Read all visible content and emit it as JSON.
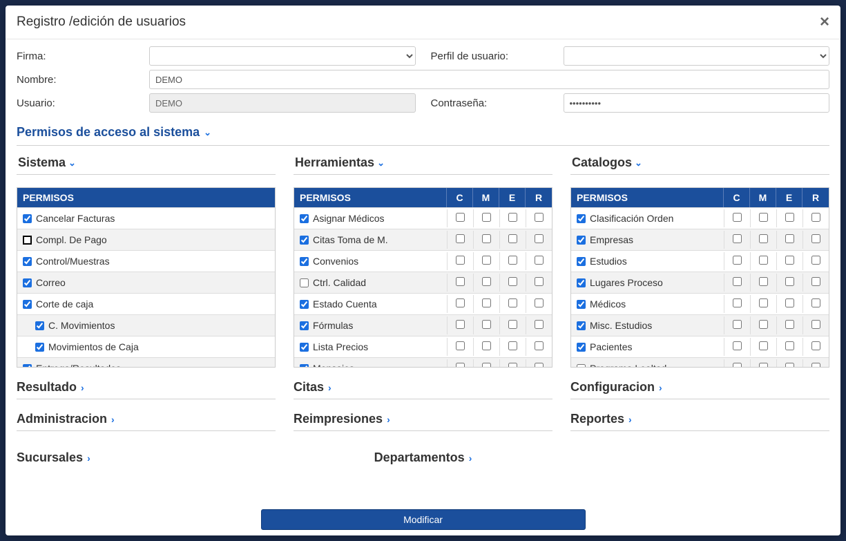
{
  "modal": {
    "title": "Registro /edición de usuarios"
  },
  "form": {
    "firma_label": "Firma:",
    "perfil_label": "Perfil de usuario:",
    "nombre_label": "Nombre:",
    "nombre_value": "DEMO",
    "usuario_label": "Usuario:",
    "usuario_value": "DEMO",
    "contrasena_label": "Contraseña:",
    "contrasena_value": "••••••••••"
  },
  "permisos_section": "Permisos de acceso al sistema",
  "cols": {
    "sistema": "Sistema",
    "herramientas": "Herramientas",
    "catalogos": "Catalogos"
  },
  "table_head": {
    "permisos": "PERMISOS",
    "c": "C",
    "m": "M",
    "e": "E",
    "r": "R"
  },
  "sistema_items": [
    {
      "label": "Cancelar Facturas",
      "checked": true,
      "outline": false
    },
    {
      "label": "Compl. De Pago",
      "checked": false,
      "outline": true
    },
    {
      "label": "Control/Muestras",
      "checked": true,
      "outline": false
    },
    {
      "label": "Correo",
      "checked": true,
      "outline": false
    },
    {
      "label": "Corte de caja",
      "checked": true,
      "outline": false
    },
    {
      "label": "C. Movimientos",
      "checked": true,
      "outline": false,
      "sub": true
    },
    {
      "label": "Movimientos de Caja",
      "checked": true,
      "outline": false,
      "sub": true
    },
    {
      "label": "Entrega/Resultados",
      "checked": true,
      "outline": false
    }
  ],
  "herramientas_items": [
    {
      "label": "Asignar Médicos",
      "checked": true
    },
    {
      "label": "Citas Toma de M.",
      "checked": true
    },
    {
      "label": "Convenios",
      "checked": true
    },
    {
      "label": "Ctrl. Calidad",
      "checked": false
    },
    {
      "label": "Estado Cuenta",
      "checked": true
    },
    {
      "label": "Fórmulas",
      "checked": true
    },
    {
      "label": "Lista Precios",
      "checked": true
    },
    {
      "label": "Mensajes",
      "checked": true
    }
  ],
  "catalogos_items": [
    {
      "label": "Clasificación Orden",
      "checked": true
    },
    {
      "label": "Empresas",
      "checked": true
    },
    {
      "label": "Estudios",
      "checked": true
    },
    {
      "label": "Lugares Proceso",
      "checked": true
    },
    {
      "label": "Médicos",
      "checked": true
    },
    {
      "label": "Misc. Estudios",
      "checked": true
    },
    {
      "label": "Pacientes",
      "checked": true
    },
    {
      "label": "Programa Lealtad",
      "checked": false
    }
  ],
  "mini": {
    "resultado": "Resultado",
    "citas": "Citas",
    "configuracion": "Configuracion",
    "administracion": "Administracion",
    "reimpresiones": "Reimpresiones",
    "reportes": "Reportes",
    "sucursales": "Sucursales",
    "departamentos": "Departamentos"
  },
  "footer": {
    "button": "Modificar"
  }
}
